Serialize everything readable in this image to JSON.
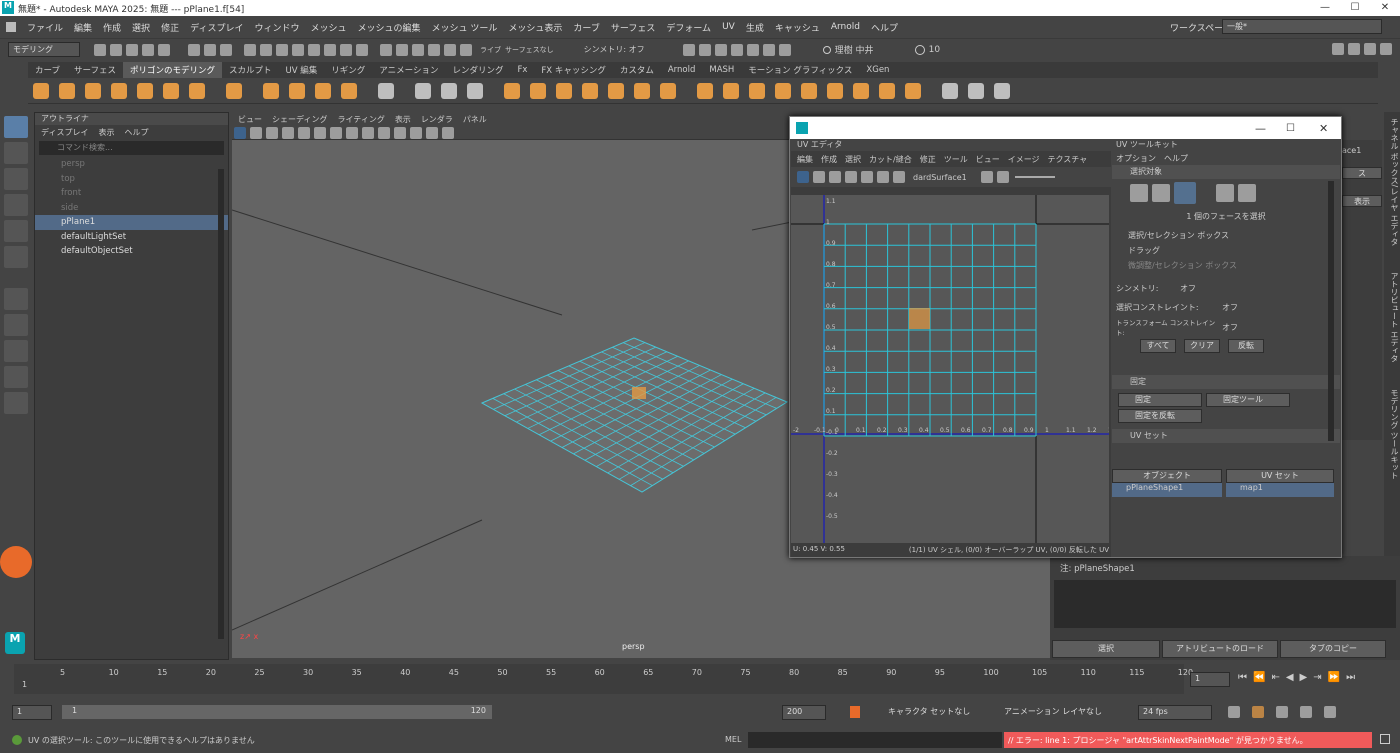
{
  "window": {
    "title": "無題* - Autodesk MAYA 2025: 無題   ---   pPlane1.f[54]",
    "minimize": "—",
    "maximize": "☐",
    "close": "✕"
  },
  "menubar": [
    "ファイル",
    "編集",
    "作成",
    "選択",
    "修正",
    "ディスプレイ",
    "ウィンドウ",
    "メッシュ",
    "メッシュの編集",
    "メッシュ ツール",
    "メッシュ表示",
    "カーブ",
    "サーフェス",
    "デフォーム",
    "UV",
    "生成",
    "キャッシュ",
    "Arnold",
    "ヘルプ"
  ],
  "workspace": {
    "label": "ワークスペース :",
    "value": "一般*"
  },
  "status": {
    "mode": "モデリング",
    "live_label": "ライブ",
    "live_value": "サーフェスなし",
    "symmetry": "シンメトリ: オフ",
    "user": "理樹 中井",
    "credits": "10"
  },
  "shelf_tabs": [
    "カーブ",
    "サーフェス",
    "ポリゴンのモデリング",
    "スカルプト",
    "UV 編集",
    "リギング",
    "アニメーション",
    "レンダリング",
    "Fx",
    "FX キャッシング",
    "カスタム",
    "Arnold",
    "MASH",
    "モーション グラフィックス",
    "XGen"
  ],
  "shelf_active": "ポリゴンのモデリング",
  "outliner": {
    "title": "アウトライナ",
    "menu": [
      "ディスプレイ",
      "表示",
      "ヘルプ"
    ],
    "search": "コマンド検索...",
    "items": [
      {
        "label": "persp",
        "dim": true
      },
      {
        "label": "top",
        "dim": true
      },
      {
        "label": "front",
        "dim": true
      },
      {
        "label": "side",
        "dim": true
      },
      {
        "label": "pPlane1",
        "hi": true
      },
      {
        "label": "defaultLightSet"
      },
      {
        "label": "defaultObjectSet"
      }
    ]
  },
  "viewport": {
    "menu": [
      "ビュー",
      "シェーディング",
      "ライティング",
      "表示",
      "レンダラ",
      "パネル"
    ],
    "camera": "persp"
  },
  "uv_editor": {
    "title": "UV エディタ",
    "menu": [
      "編集",
      "作成",
      "選択",
      "カット/縫合",
      "修正",
      "ツール",
      "ビュー",
      "イメージ",
      "テクスチャ"
    ],
    "surface": "dardSurface1",
    "coord": "U:  0.45 V:  0.55",
    "info": "(1/1) UV シェル, (0/0) オーバーラップ UV, (0/0) 反転した UV",
    "ticks_v": [
      "1.1",
      "1",
      "0.9",
      "0.8",
      "0.7",
      "0.6",
      "0.5",
      "0.4",
      "0.3",
      "0.2",
      "0.1",
      "-0.1",
      "-0.2",
      "-0.3",
      "-0.4",
      "-0.5"
    ],
    "ticks_u": [
      "-2",
      "-0.1",
      "0",
      "0.1",
      "0.2",
      "0.3",
      "0.4",
      "0.5",
      "0.6",
      "0.7",
      "0.8",
      "0.9",
      "1",
      "1.1",
      "1.2",
      "1"
    ]
  },
  "uv_toolkit": {
    "title": "UV ツールキット",
    "menu": [
      "オプション",
      "ヘルプ"
    ],
    "sel_section": "選択対象",
    "sel_info": "1 個のフェースを選択",
    "options": [
      "選択/セレクション ボックス",
      "ドラッグ",
      "微調整/セレクション ボックス"
    ],
    "symmetry_label": "シンメトリ:",
    "symmetry_value": "オフ",
    "constraint_label": "選択コンストレイント:",
    "constraint_value": "オフ",
    "transform_label": "トランスフォーム コンストレイント:",
    "transform_value": "オフ",
    "btn_all": "すべて",
    "btn_clear": "クリア",
    "btn_invert": "反転",
    "pin_section": "固定",
    "pin": "固定",
    "pin_tool": "固定ツール",
    "pin_invert": "固定を反転",
    "uvset_section": "UV セット",
    "col_object": "オブジェクト",
    "col_uvset": "UV セット",
    "obj_value": "pPlaneShape1",
    "uvset_value": "map1"
  },
  "right_tabs": [
    "チャネル ボックス/レイヤ エディタ",
    "アトリビュート エディタ",
    "モデリング ツールキット"
  ],
  "attr": {
    "note": "注: pPlaneShape1",
    "btn_select": "選択",
    "btn_load": "アトリビュートのロード",
    "btn_copy": "タブのコピー",
    "partial1": "ace1",
    "partial2": "ス",
    "partial3": "表示"
  },
  "timeline": {
    "ticks": [
      "5",
      "10",
      "15",
      "20",
      "25",
      "30",
      "35",
      "40",
      "45",
      "50",
      "55",
      "60",
      "65",
      "70",
      "75",
      "80",
      "85",
      "90",
      "95",
      "100",
      "105",
      "110",
      "115",
      "120"
    ],
    "current": "1",
    "frame_field": "1"
  },
  "range": {
    "start": "1",
    "inner_start": "1",
    "inner_end": "120",
    "end": "200",
    "charset": "キャラクタ セットなし",
    "animlayer": "アニメーション レイヤなし",
    "fps": "24 fps"
  },
  "cmd": {
    "help": "UV の選択ツール: このツールに使用できるヘルプはありません",
    "mel": "MEL",
    "error": "// エラー: line 1: プロシージャ \"artAttrSkinNextPaintMode\" が見つかりません。"
  }
}
